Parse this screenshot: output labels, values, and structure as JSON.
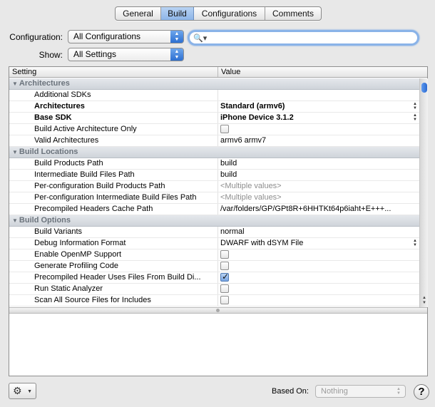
{
  "tabs": [
    {
      "label": "General"
    },
    {
      "label": "Build"
    },
    {
      "label": "Configurations"
    },
    {
      "label": "Comments"
    }
  ],
  "configuration": {
    "label": "Configuration:",
    "value": "All Configurations"
  },
  "show": {
    "label": "Show:",
    "value": "All Settings"
  },
  "search": {
    "value": "",
    "icon": "search-icon"
  },
  "table": {
    "headers": {
      "setting": "Setting",
      "value": "Value"
    },
    "sections": [
      {
        "title": "Architectures",
        "rows": [
          {
            "name": "Additional SDKs",
            "value": ""
          },
          {
            "name": "Architectures",
            "value": "Standard (armv6)"
          },
          {
            "name": "Base SDK",
            "value": "iPhone Device 3.1.2"
          },
          {
            "name": "Build Active Architecture Only",
            "value": ""
          },
          {
            "name": "Valid Architectures",
            "value": "armv6 armv7"
          }
        ]
      },
      {
        "title": "Build Locations",
        "rows": [
          {
            "name": "Build Products Path",
            "value": "build"
          },
          {
            "name": "Intermediate Build Files Path",
            "value": "build"
          },
          {
            "name": "Per-configuration Build Products Path",
            "value": "<Multiple values>"
          },
          {
            "name": "Per-configuration Intermediate Build Files Path",
            "value": "<Multiple values>"
          },
          {
            "name": "Precompiled Headers Cache Path",
            "value": "/var/folders/GP/GPt8R+6HHTKt64p6iaht+E+++..."
          }
        ]
      },
      {
        "title": "Build Options",
        "rows": [
          {
            "name": "Build Variants",
            "value": "normal"
          },
          {
            "name": "Debug Information Format",
            "value": "DWARF with dSYM File"
          },
          {
            "name": "Enable OpenMP Support",
            "value": ""
          },
          {
            "name": "Generate Profiling Code",
            "value": ""
          },
          {
            "name": "Precompiled Header Uses Files From Build Di...",
            "value": ""
          },
          {
            "name": "Run Static Analyzer",
            "value": ""
          },
          {
            "name": "Scan All Source Files for Includes",
            "value": ""
          }
        ]
      }
    ]
  },
  "bottom": {
    "based_on_label": "Based On:",
    "based_on_value": "Nothing",
    "help_label": "?"
  },
  "colors": {
    "accent": "#3d7bd9",
    "section_text": "#6b737c"
  }
}
